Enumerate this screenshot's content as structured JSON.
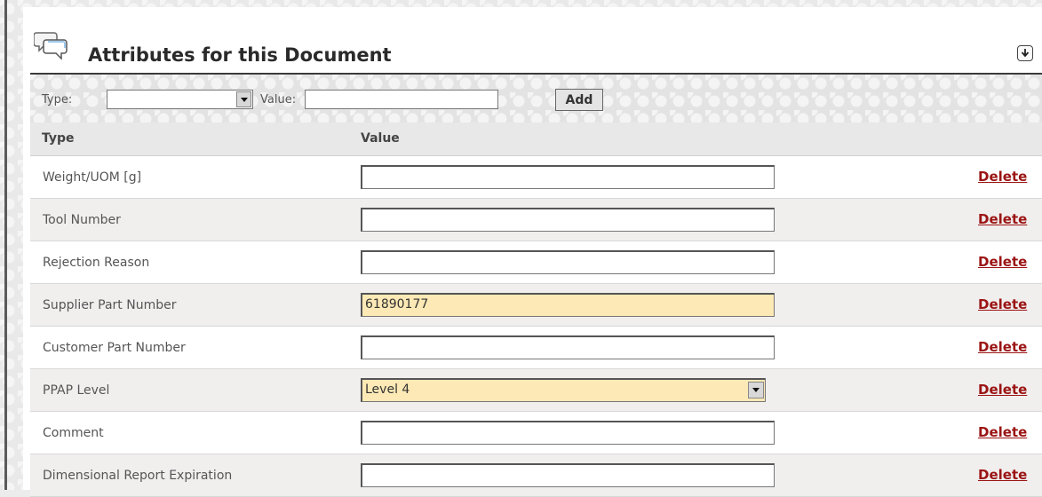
{
  "header": {
    "title": "Attributes for this Document"
  },
  "add_bar": {
    "type_label": "Type:",
    "type_value": "",
    "value_label": "Value:",
    "value_value": "",
    "add_label": "Add"
  },
  "columns": {
    "type": "Type",
    "value": "Value"
  },
  "rows": [
    {
      "type": "Weight/UOM [g]",
      "value": "",
      "action": "Delete"
    },
    {
      "type": "Tool Number",
      "value": "",
      "action": "Delete"
    },
    {
      "type": "Rejection Reason",
      "value": "",
      "action": "Delete"
    },
    {
      "type": "Supplier Part Number",
      "value": "61890177",
      "action": "Delete"
    },
    {
      "type": "Customer Part Number",
      "value": "",
      "action": "Delete"
    },
    {
      "type": "PPAP Level",
      "value": "Level 4",
      "action": "Delete"
    },
    {
      "type": "Comment",
      "value": "",
      "action": "Delete"
    },
    {
      "type": "Dimensional Report Expiration",
      "value": "",
      "action": "Delete"
    }
  ],
  "icons": {
    "title": "speech-bubbles-icon",
    "collapse": "collapse-down-arrow-icon",
    "dropdown": "chevron-down-icon"
  },
  "colors": {
    "highlight_field": "#fce9b5",
    "delete_link": "#9b1414",
    "header_rule": "#3a3a3a"
  }
}
